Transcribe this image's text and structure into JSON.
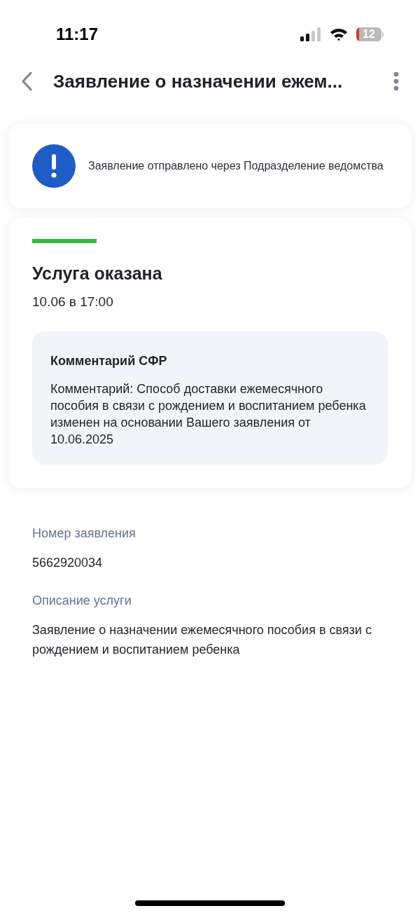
{
  "status_bar": {
    "time": "11:17",
    "battery": "12"
  },
  "header": {
    "title": "Заявление о назначении ежем..."
  },
  "notice": {
    "text": "Заявление отправлено через Подразделение ведомства"
  },
  "status_card": {
    "color": "#33b845",
    "title": "Услуга оказана",
    "date": "10.06 в 17:00",
    "comment": {
      "title": "Комментарий СФР",
      "text": "Комментарий: Способ доставки ежемесячного пособия в связи с рождением и воспитанием ребенка изменен на основании Вашего заявления от 10.06.2025"
    }
  },
  "details": [
    {
      "label": "Номер заявления",
      "value": "5662920034"
    },
    {
      "label": "Описание услуги",
      "value": "Заявление о назначении ежемесячного пособия в связи с рождением и воспитанием ребенка"
    }
  ]
}
